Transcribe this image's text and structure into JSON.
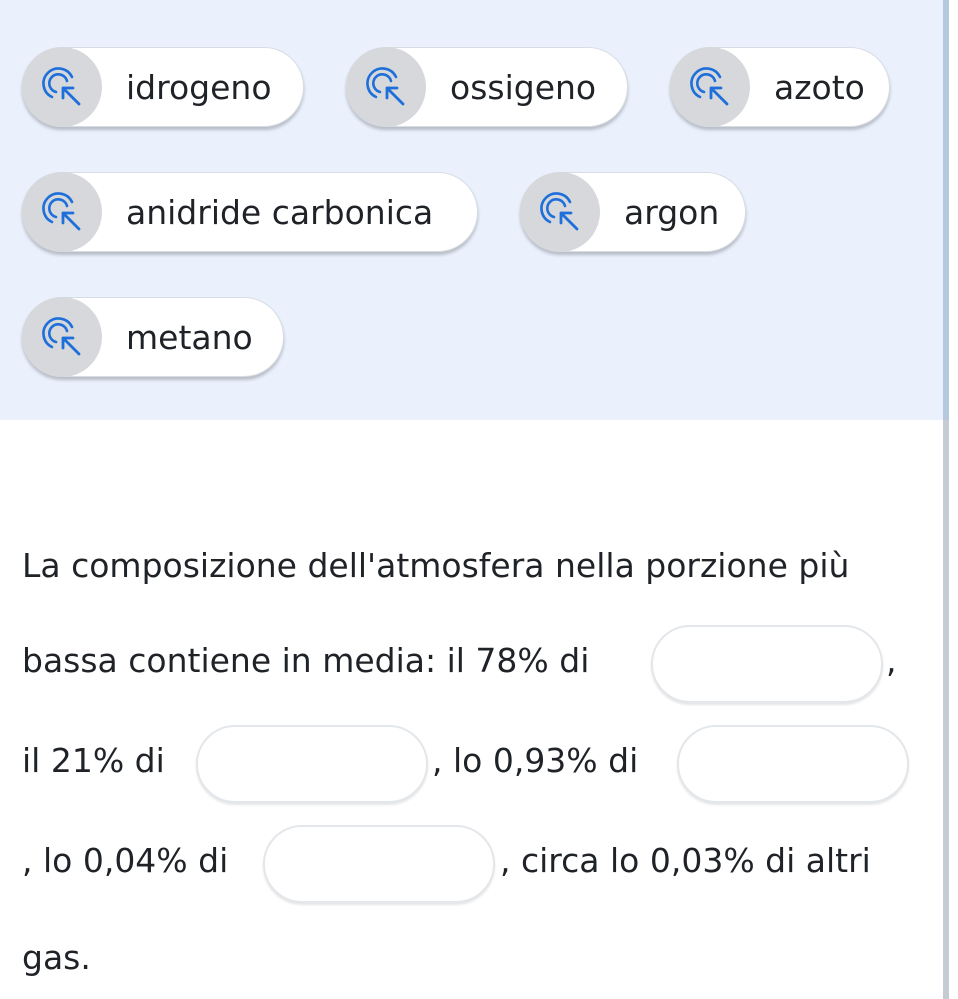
{
  "colors": {
    "bank_background": "#eaf1fd",
    "chip_background": "#ffffff",
    "icon_circle": "#d6d8dc",
    "icon_accent": "#1e6fd9"
  },
  "word_bank": {
    "icon": "touch-pointer-icon",
    "chips": [
      {
        "label": "idrogeno"
      },
      {
        "label": "ossigeno"
      },
      {
        "label": "azoto"
      },
      {
        "label": "anidride carbonica"
      },
      {
        "label": "argon"
      },
      {
        "label": "metano"
      }
    ]
  },
  "exercise": {
    "line1": "La composizione dell'atmosfera nella porzione più",
    "line2_text": "bassa contiene in media: il 78% di",
    "line2_after": ",",
    "line3_text": "il 21% di",
    "line3_middle": ", lo 0,93% di",
    "line4_text": ", lo 0,04% di",
    "line4_after": ", circa lo 0,03% di altri",
    "line5": "gas."
  }
}
